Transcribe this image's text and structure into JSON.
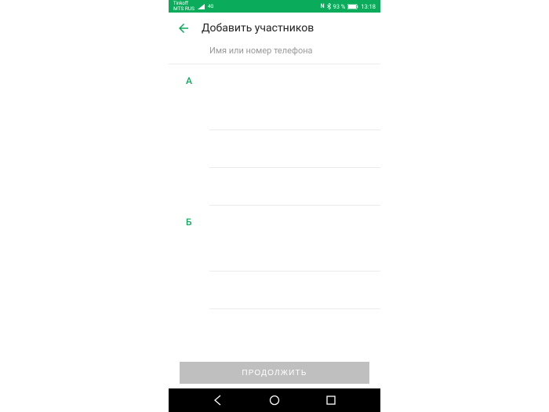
{
  "status": {
    "carrier_top": "Tinkoff",
    "carrier_bottom": "MTS RUS",
    "net": "4G",
    "nfc": "N",
    "bt": "",
    "battery": "93 %",
    "time": "13:18"
  },
  "header": {
    "title": "Добавить участников",
    "search_placeholder": "Имя или номер телефона"
  },
  "sections": [
    {
      "letter": "А",
      "rows": 3
    },
    {
      "letter": "Б",
      "rows": 3
    }
  ],
  "footer": {
    "continue_label": "ПРОДОЛЖИТЬ"
  }
}
